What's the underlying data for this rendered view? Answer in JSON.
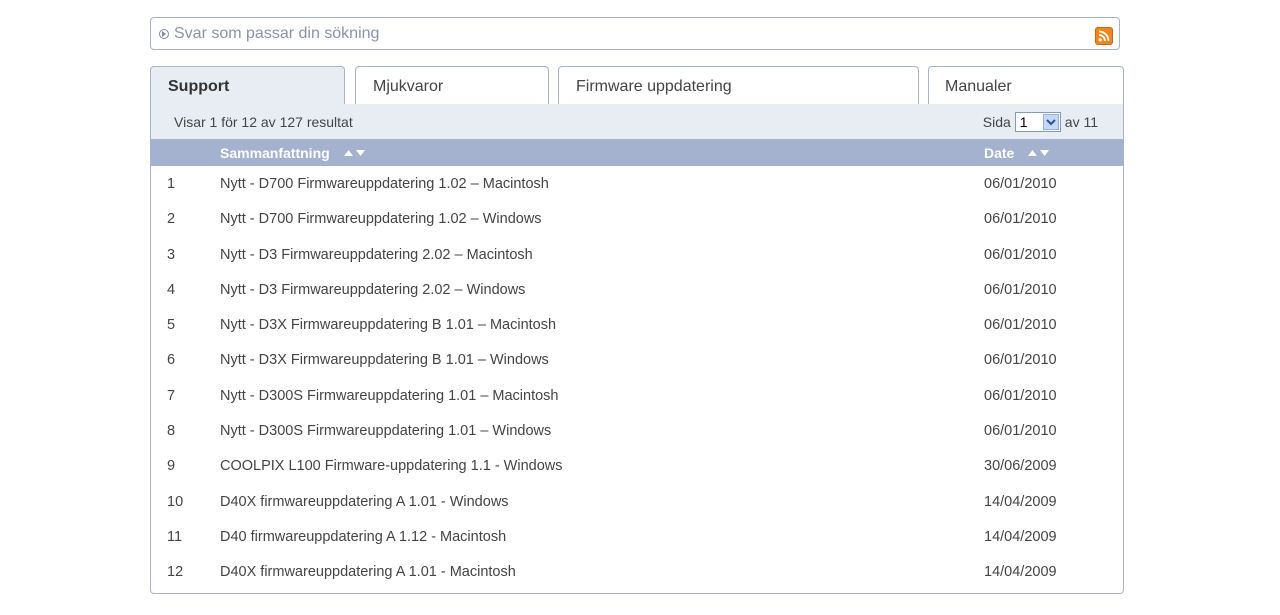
{
  "answer_bar": {
    "title": "Svar som passar din sökning"
  },
  "tabs": [
    {
      "label": "Support",
      "active": true
    },
    {
      "label": "Mjukvaror",
      "active": false
    },
    {
      "label": "Firmware uppdatering",
      "active": false
    },
    {
      "label": "Manualer",
      "active": false
    }
  ],
  "results": {
    "count_text": "Visar 1 för 12 av 127 resultat",
    "page_label": "Sida",
    "page_value": "1",
    "page_total": "av 11"
  },
  "columns": {
    "summary": "Sammanfattning",
    "date": "Date"
  },
  "rows": [
    {
      "num": "1",
      "desc": "Nytt  -  D700 Firmwareuppdatering 1.02 – Macintosh",
      "date": "06/01/2010"
    },
    {
      "num": "2",
      "desc": "Nytt  -  D700 Firmwareuppdatering 1.02 – Windows",
      "date": "06/01/2010"
    },
    {
      "num": "3",
      "desc": "Nytt  -  D3 Firmwareuppdatering 2.02 – Macintosh",
      "date": "06/01/2010"
    },
    {
      "num": "4",
      "desc": "Nytt  -  D3 Firmwareuppdatering 2.02 – Windows",
      "date": "06/01/2010"
    },
    {
      "num": "5",
      "desc": "Nytt  -  D3X Firmwareuppdatering B 1.01 – Macintosh",
      "date": "06/01/2010"
    },
    {
      "num": "6",
      "desc": "Nytt  -  D3X Firmwareuppdatering B 1.01 – Windows",
      "date": "06/01/2010"
    },
    {
      "num": "7",
      "desc": "Nytt  -  D300S Firmwareuppdatering 1.01 – Macintosh",
      "date": "06/01/2010"
    },
    {
      "num": "8",
      "desc": "Nytt  -  D300S Firmwareuppdatering 1.01 – Windows",
      "date": "06/01/2010"
    },
    {
      "num": "9",
      "desc": "COOLPIX L100 Firmware-uppdatering 1.1 - Windows",
      "date": "30/06/2009"
    },
    {
      "num": "10",
      "desc": "D40X firmwareuppdatering A 1.01 - Windows",
      "date": "14/04/2009"
    },
    {
      "num": "11",
      "desc": "D40 firmwareuppdatering A 1.12 - Macintosh",
      "date": "14/04/2009"
    },
    {
      "num": "12",
      "desc": "D40X firmwareuppdatering A 1.01 - Macintosh",
      "date": "14/04/2009"
    }
  ],
  "colors": {
    "accent": "#a4b2cf",
    "info_bg": "#e8ecf3",
    "border": "#a8b3cc",
    "rss": "#f1861e"
  }
}
